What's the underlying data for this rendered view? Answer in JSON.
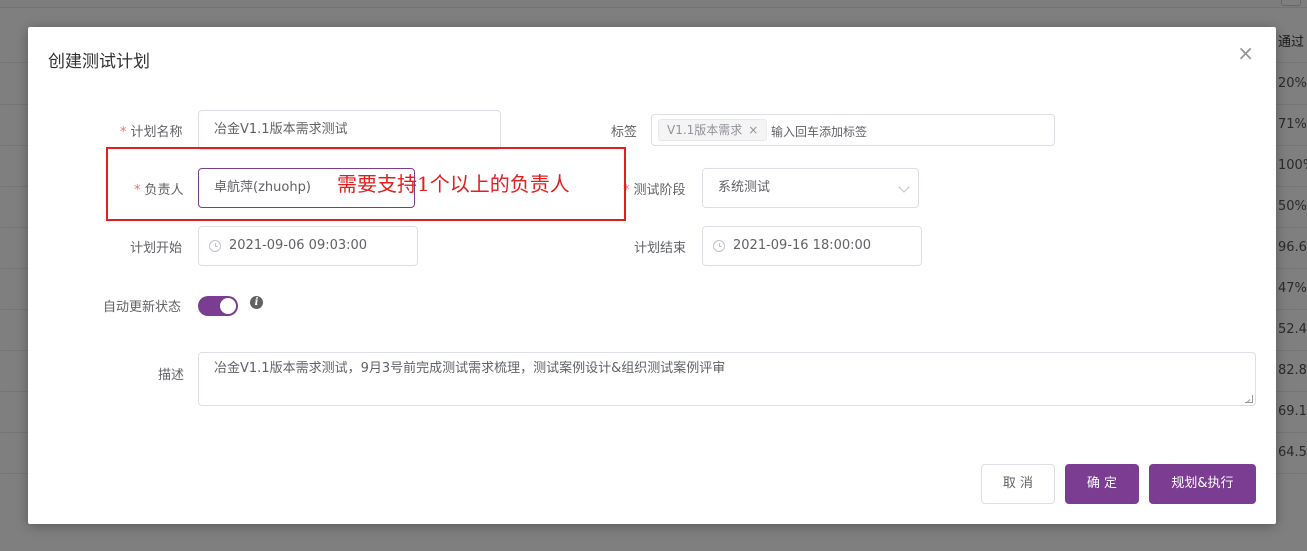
{
  "background": {
    "column_header": "通过",
    "cells": [
      "20%",
      "71%",
      "100%",
      "50%",
      "96.6",
      "47%",
      "52.4",
      "82.8",
      "69.1",
      "64.5"
    ]
  },
  "dialog": {
    "title": "创建测试计划",
    "close_icon": "×"
  },
  "form": {
    "plan_name": {
      "label": "计划名称",
      "value": "冶金V1.1版本需求测试"
    },
    "tags": {
      "label": "标签",
      "tag": "V1.1版本需求",
      "tag_close": "×",
      "placeholder": "输入回车添加标签"
    },
    "owner": {
      "label": "负责人",
      "value": "卓航萍(zhuohp)"
    },
    "stage": {
      "label": "测试阶段",
      "value": "系统测试"
    },
    "start": {
      "label": "计划开始",
      "value": "2021-09-06 09:03:00"
    },
    "end": {
      "label": "计划结束",
      "value": "2021-09-16 18:00:00"
    },
    "auto_update": {
      "label": "自动更新状态",
      "enabled": true,
      "info_icon": "i"
    },
    "description": {
      "label": "描述",
      "value": "冶金V1.1版本需求测试，9月3号前完成测试需求梳理，测试案例设计&组织测试案例评审"
    },
    "required_mark": "*"
  },
  "buttons": {
    "cancel": "取 消",
    "confirm": "确 定",
    "plan_execute": "规划&执行"
  },
  "annotation": {
    "text": "需要支持1个以上的负责人"
  },
  "colors": {
    "accent": "#7b3d92",
    "annotation": "#e02020",
    "required": "#f56c6c"
  }
}
